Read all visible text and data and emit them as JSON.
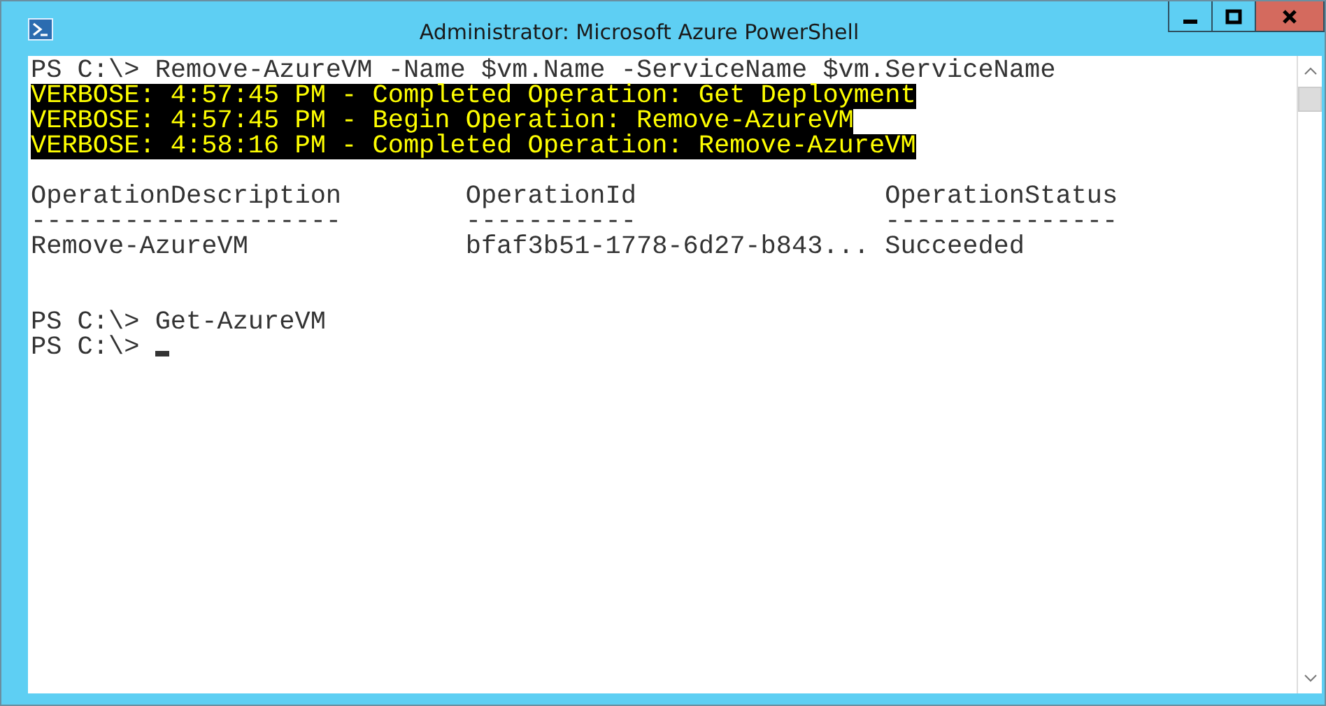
{
  "window": {
    "title": "Administrator: Microsoft Azure PowerShell"
  },
  "console": {
    "lines": [
      {
        "kind": "command",
        "text": "PS C:\\> Remove-AzureVM -Name $vm.Name -ServiceName $vm.ServiceName"
      },
      {
        "kind": "verbose",
        "text": "VERBOSE: 4:57:45 PM - Completed Operation: Get Deployment"
      },
      {
        "kind": "verbose",
        "text": "VERBOSE: 4:57:45 PM - Begin Operation: Remove-AzureVM"
      },
      {
        "kind": "verbose",
        "text": "VERBOSE: 4:58:16 PM - Completed Operation: Remove-AzureVM"
      },
      {
        "kind": "blank"
      },
      {
        "kind": "output",
        "text": "OperationDescription        OperationId                OperationStatus"
      },
      {
        "kind": "output",
        "text": "--------------------        -----------                ---------------"
      },
      {
        "kind": "output",
        "text": "Remove-AzureVM              bfaf3b51-1778-6d27-b843... Succeeded"
      },
      {
        "kind": "blank"
      },
      {
        "kind": "blank"
      },
      {
        "kind": "command",
        "text": "PS C:\\> Get-AzureVM"
      },
      {
        "kind": "prompt",
        "text": "PS C:\\> "
      }
    ]
  }
}
